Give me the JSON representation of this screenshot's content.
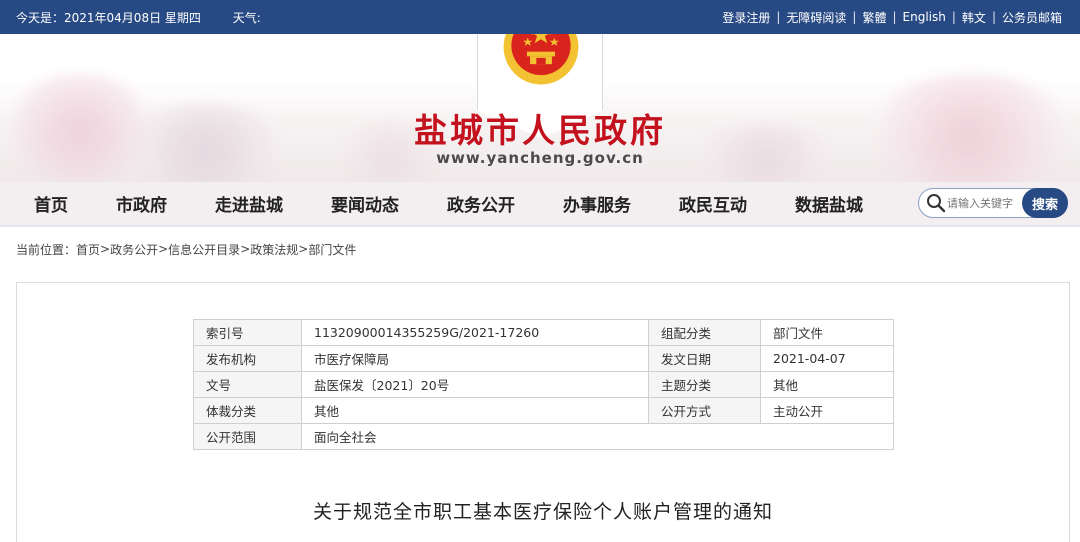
{
  "topbar": {
    "date_text": "今天是：2021年04月08日 星期四",
    "weather_label": "天气:",
    "links": [
      "登录注册",
      "无障碍阅读",
      "繁體",
      "English",
      "韩文",
      "公务员邮箱"
    ]
  },
  "header": {
    "site_title": "盐城市人民政府",
    "site_url": "www.yancheng.gov.cn",
    "emblem_icon": "national-emblem-icon"
  },
  "nav": {
    "items": [
      "首页",
      "市政府",
      "走进盐城",
      "要闻动态",
      "政务公开",
      "办事服务",
      "政民互动",
      "数据盐城"
    ],
    "search_placeholder": "请输入关键字",
    "search_button": "搜索"
  },
  "breadcrumb": {
    "prefix": "当前位置：",
    "items": [
      "首页",
      "政务公开",
      "信息公开目录",
      "政策法规",
      "部门文件"
    ],
    "separator": ">"
  },
  "meta_table": {
    "rows": [
      [
        "索引号",
        "11320900014355259G/2021-17260",
        "组配分类",
        "部门文件"
      ],
      [
        "发布机构",
        "市医疗保障局",
        "发文日期",
        "2021-04-07"
      ],
      [
        "文号",
        "盐医保发〔2021〕20号",
        "主题分类",
        "其他"
      ],
      [
        "体裁分类",
        "其他",
        "公开方式",
        "主动公开"
      ],
      [
        "公开范围",
        "面向全社会"
      ]
    ]
  },
  "document": {
    "title": "关于规范全市职工基本医疗保险个人账户管理的通知"
  },
  "colors": {
    "primary_blue": "#284a84",
    "title_red": "#c3121e",
    "emblem_red": "#d9241e",
    "emblem_gold": "#f3c233"
  }
}
